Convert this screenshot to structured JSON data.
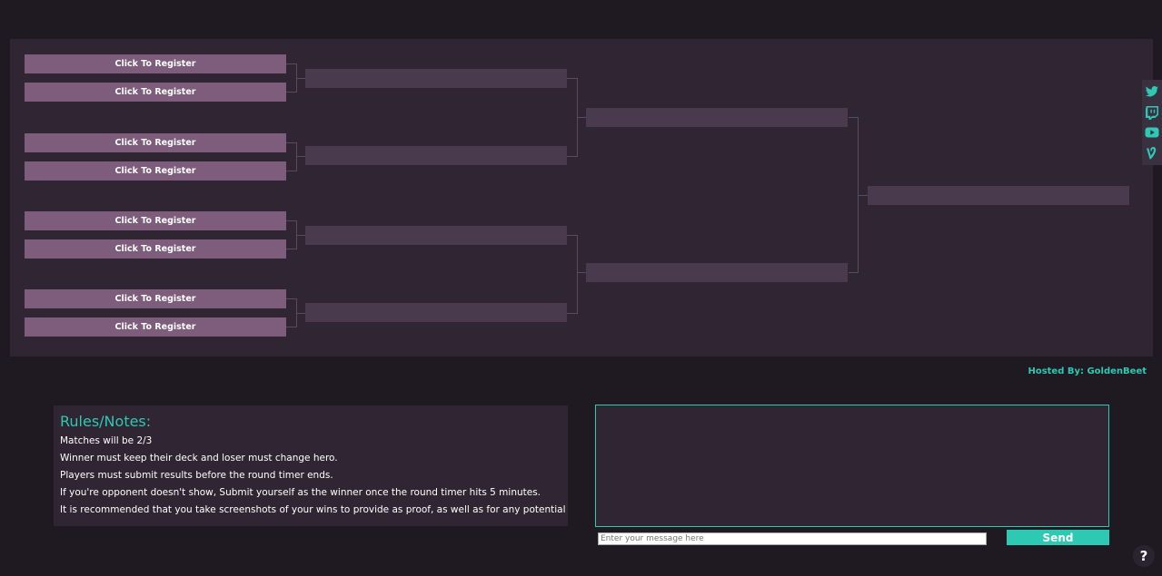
{
  "bracket": {
    "round1": [
      {
        "label": "Click To Register"
      },
      {
        "label": "Click To Register"
      },
      {
        "label": "Click To Register"
      },
      {
        "label": "Click To Register"
      },
      {
        "label": "Click To Register"
      },
      {
        "label": "Click To Register"
      },
      {
        "label": "Click To Register"
      },
      {
        "label": "Click To Register"
      }
    ],
    "round2": [
      "",
      "",
      "",
      ""
    ],
    "round3": [
      "",
      ""
    ],
    "final": [
      ""
    ]
  },
  "social": [
    "twitter-icon",
    "twitch-icon",
    "youtube-icon",
    "vine-icon"
  ],
  "hosted_by": "Hosted By: GoldenBeet",
  "rules": {
    "title": "Rules/Notes:",
    "lines": [
      "Matches will be 2/3",
      "Winner must keep their deck and loser must change hero.",
      "Players must submit results before the round timer ends.",
      "If you're opponent doesn't show, Submit yourself as the winner once the round timer hits 5 minutes.",
      "It is recommended that you take screenshots of your wins to provide as proof, as well as for any potential"
    ]
  },
  "chat": {
    "placeholder": "Enter your message here",
    "send_label": "Send"
  },
  "help": "?",
  "colors": {
    "accent": "#2ec9b3",
    "slot": "#7d5c7c",
    "panel": "#2f2533",
    "background": "#1f1a22"
  }
}
